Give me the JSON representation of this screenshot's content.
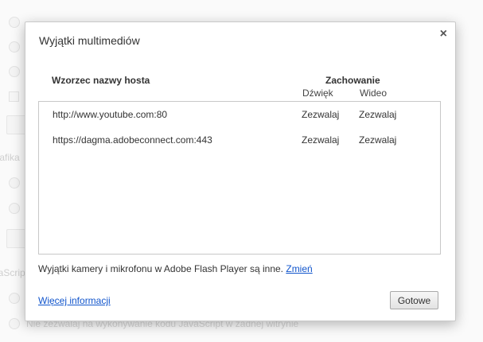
{
  "background": {
    "section_grafika": "Grafika",
    "section_javascript": "JavaScript",
    "js_block_option": "Nie zezwalaj na wykonywanie kodu JavaScript w żadnej witrynie"
  },
  "dialog": {
    "title": "Wyjątki multimediów",
    "close_label": "×",
    "columns": {
      "host": "Wzorzec nazwy hosta",
      "behavior": "Zachowanie",
      "sound": "Dźwięk",
      "video": "Wideo"
    },
    "rows": [
      {
        "host": "http://www.youtube.com:80",
        "sound": "Zezwalaj",
        "video": "Zezwalaj"
      },
      {
        "host": "https://dagma.adobeconnect.com:443",
        "sound": "Zezwalaj",
        "video": "Zezwalaj"
      }
    ],
    "note": "Wyjątki kamery i mikrofonu w Adobe Flash Player są inne.",
    "note_link": "Zmień",
    "more_info": "Więcej informacji",
    "done_label": "Gotowe"
  },
  "colors": {
    "link": "#1155cc",
    "dialog_border": "#c9c9c9"
  }
}
